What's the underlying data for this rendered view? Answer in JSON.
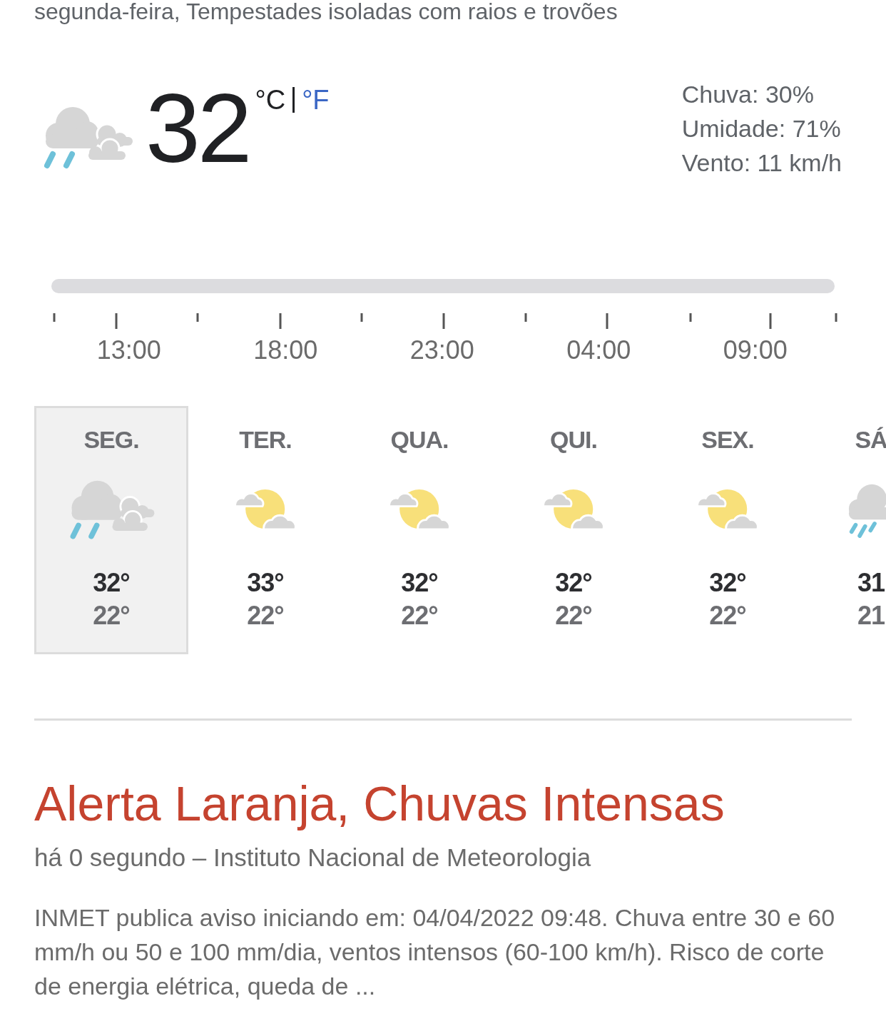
{
  "summary": "segunda-feira, Tempestades isoladas com raios e trovões",
  "current": {
    "kind": "storm",
    "temperature": "32",
    "units": [
      {
        "label": "°C",
        "selected": true
      },
      {
        "label": "°F",
        "selected": false
      }
    ],
    "details": [
      "Chuva: 30%",
      "Umidade: 71%",
      "Vento: 11 km/h"
    ]
  },
  "timeline": {
    "labels": [
      "13:00",
      "18:00",
      "23:00",
      "04:00",
      "09:00"
    ]
  },
  "days": [
    {
      "label": "SEG.",
      "kind": "storm",
      "high": "32°",
      "low": "22°",
      "selected": true
    },
    {
      "label": "TER.",
      "kind": "partly-sunny",
      "high": "33°",
      "low": "22°",
      "selected": false
    },
    {
      "label": "QUA.",
      "kind": "partly-sunny",
      "high": "32°",
      "low": "22°",
      "selected": false
    },
    {
      "label": "QUI.",
      "kind": "partly-sunny",
      "high": "32°",
      "low": "22°",
      "selected": false
    },
    {
      "label": "SEX.",
      "kind": "partly-sunny",
      "high": "32°",
      "low": "22°",
      "selected": false
    },
    {
      "label": "SÁ",
      "kind": "rain",
      "high": "31",
      "low": "21",
      "selected": false
    }
  ],
  "alert": {
    "title": "Alerta Laranja, Chuvas Intensas",
    "source": "há 0 segundo – Instituto Nacional de Meteorologia",
    "text": "INMET publica aviso iniciando em: 04/04/2022 09:48. Chuva entre 30 e 60 mm/h ou 50 e 100 mm/dia, ventos intensos (60-100 km/h). Risco de corte de energia elétrica, queda de ..."
  }
}
